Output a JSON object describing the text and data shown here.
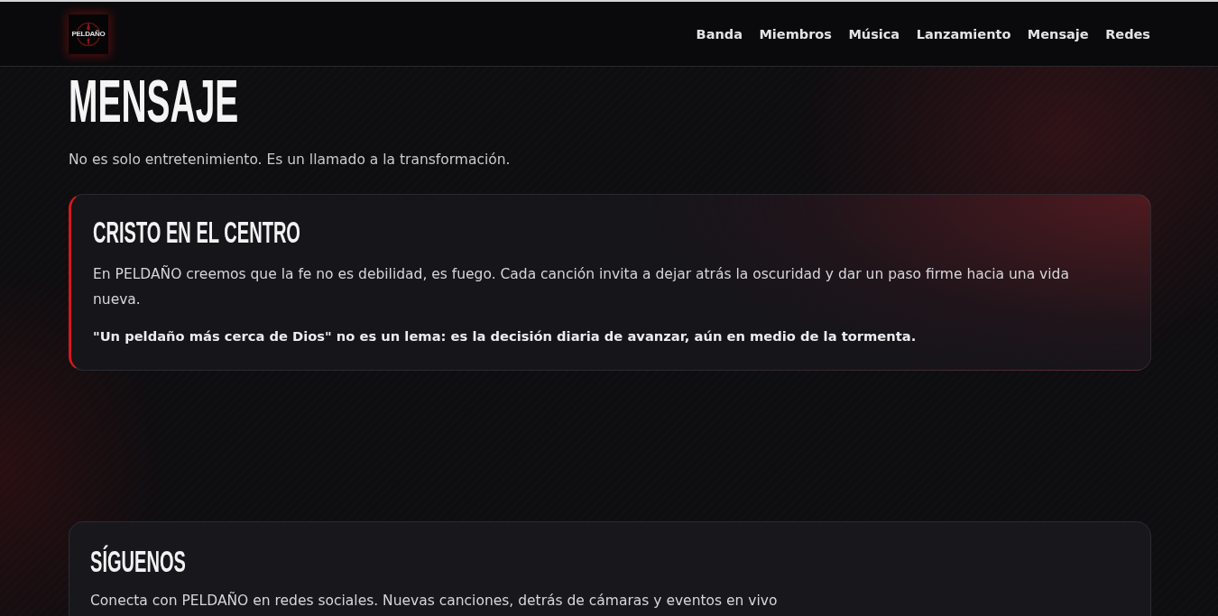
{
  "header": {
    "logo_text": "PELDAÑO",
    "nav": [
      "Banda",
      "Miembros",
      "Música",
      "Lanzamiento",
      "Mensaje",
      "Redes"
    ]
  },
  "message_section": {
    "title": "MENSAJE",
    "subtitle": "No es solo entretenimiento. Es un llamado a la transformación.",
    "card": {
      "title": "CRISTO EN EL CENTRO",
      "paragraphs": [
        {
          "kind": "plain",
          "text": "En PELDAÑO creemos que la fe no es debilidad, es fuego. Cada canción invita a dejar atrás la oscuridad y dar un paso firme hacia una vida nueva."
        },
        {
          "kind": "emphasis",
          "text": "\"Un peldaño más cerca de Dios\" no es un lema: es la decisión diaria de avanzar, aún en medio de la tormenta."
        }
      ]
    }
  },
  "follow_section": {
    "title": "SÍGUENOS",
    "text": "Conecta con PELDAÑO en redes sociales. Nuevas canciones, detrás de cámaras y eventos en vivo"
  }
}
